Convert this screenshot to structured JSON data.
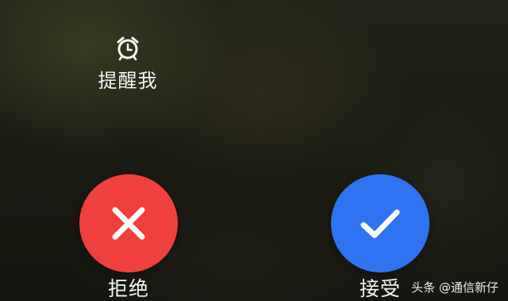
{
  "remind": {
    "icon": "alarm-clock-icon",
    "label": "提醒我"
  },
  "decline": {
    "icon": "close-icon",
    "label": "拒绝",
    "color": "#f0403d"
  },
  "accept": {
    "icon": "check-icon",
    "label": "接受",
    "color": "#2f73f2"
  },
  "watermark": {
    "text": "头条 @通信新仔"
  }
}
